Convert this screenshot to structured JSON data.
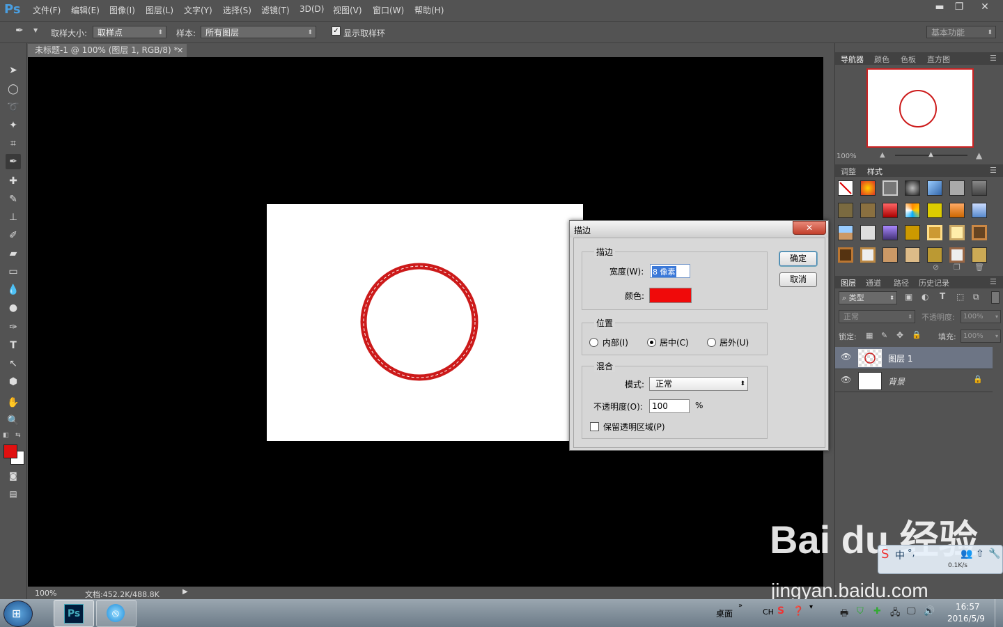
{
  "app": {
    "logo": "Ps"
  },
  "menu": [
    "文件(F)",
    "编辑(E)",
    "图像(I)",
    "图层(L)",
    "文字(Y)",
    "选择(S)",
    "滤镜(T)",
    "3D(D)",
    "视图(V)",
    "窗口(W)",
    "帮助(H)"
  ],
  "window_controls": {
    "minimize": "▬",
    "restore": "❐",
    "close": "✕"
  },
  "options": {
    "sample_size_label": "取样大小:",
    "sample_size_value": "取样点",
    "sample_label": "样本:",
    "sample_value": "所有图层",
    "show_ring_label": "显示取样环",
    "show_ring_checked": true,
    "workspace": "基本功能"
  },
  "document": {
    "tab_title": "未标题-1 @ 100% (图层 1, RGB/8) *",
    "zoom": "100%",
    "doc_info": "文档:452.2K/488.8K",
    "circle_color": "#cc1a1a"
  },
  "colors": {
    "foreground": "#e01010",
    "background": "#ffffff"
  },
  "navigator": {
    "tabs": [
      "导航器",
      "颜色",
      "色板",
      "直方图"
    ],
    "zoom": "100%"
  },
  "styles_panel": {
    "tabs": [
      "调整",
      "样式"
    ]
  },
  "layers_panel": {
    "tabs": [
      "图层",
      "通道",
      "路径",
      "历史记录"
    ],
    "filter_kind": "类型",
    "blend_mode": "正常",
    "opacity_label": "不透明度:",
    "opacity_value": "100%",
    "lock_label": "锁定:",
    "fill_label": "填充:",
    "fill_value": "100%",
    "layers": [
      {
        "name": "图层 1",
        "selected": true
      },
      {
        "name": "背景",
        "selected": false,
        "locked": true
      }
    ]
  },
  "dialog": {
    "title": "描边",
    "stroke_group": "描边",
    "width_label": "宽度(W):",
    "width_value": "8 像素",
    "color_label": "颜色:",
    "stroke_color": "#f00a0a",
    "position_group": "位置",
    "position_options": [
      "内部(I)",
      "居中(C)",
      "居外(U)"
    ],
    "position_selected": 1,
    "blend_group": "混合",
    "mode_label": "模式:",
    "mode_value": "正常",
    "opacity_label": "不透明度(O):",
    "opacity_value": "100",
    "opacity_unit": "%",
    "preserve_label": "保留透明区域(P)",
    "ok": "确定",
    "cancel": "取消"
  },
  "watermark": {
    "brand": "Bai du 经验",
    "url": "jingyan.baidu.com"
  },
  "netspeed": "0.1K/s",
  "taskbar": {
    "desktop_label": "桌面",
    "lang": "CH",
    "time": "16:57",
    "date": "2016/5/9"
  }
}
